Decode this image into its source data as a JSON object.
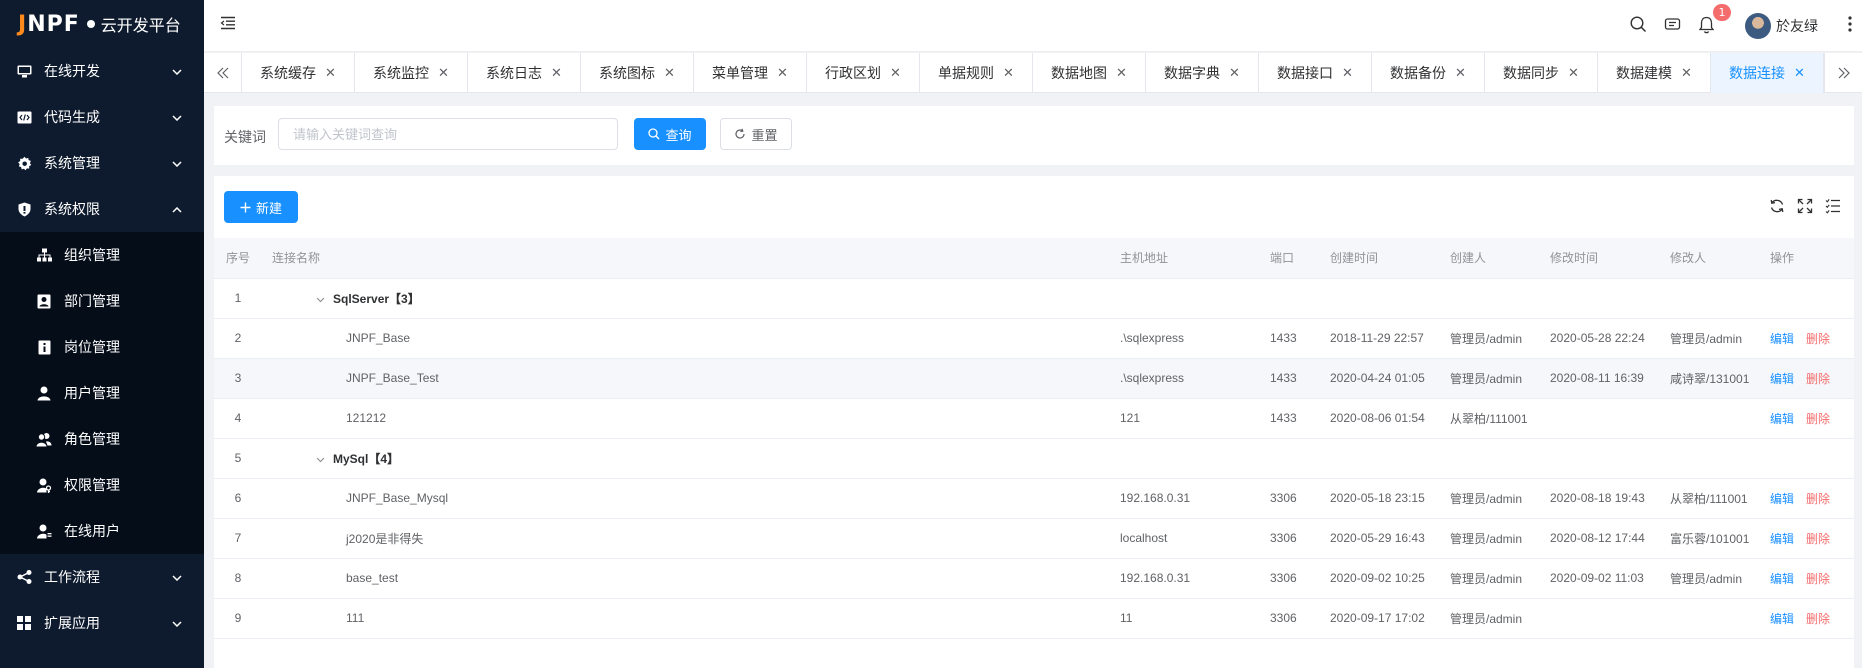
{
  "app": {
    "brand": "JNPF",
    "brand_first": "J",
    "brand_rest": "NPF",
    "platform": "云开发平台"
  },
  "sidebar": {
    "menus": [
      {
        "label": "在线开发",
        "icon": "monitor-icon"
      },
      {
        "label": "代码生成",
        "icon": "code-icon"
      },
      {
        "label": "系统管理",
        "icon": "gear-icon"
      },
      {
        "label": "系统权限",
        "icon": "shield-icon"
      }
    ],
    "sub_items": [
      {
        "label": "组织管理",
        "icon": "org-tree-icon"
      },
      {
        "label": "部门管理",
        "icon": "id-card-icon"
      },
      {
        "label": "岗位管理",
        "icon": "post-icon"
      },
      {
        "label": "用户管理",
        "icon": "user-icon"
      },
      {
        "label": "角色管理",
        "icon": "users-icon"
      },
      {
        "label": "权限管理",
        "icon": "user-key-icon"
      },
      {
        "label": "在线用户",
        "icon": "user-online-icon"
      }
    ],
    "bottom_menus": [
      {
        "label": "工作流程",
        "icon": "share-icon"
      },
      {
        "label": "扩展应用",
        "icon": "grid-icon"
      }
    ]
  },
  "header": {
    "notification_count": "1",
    "username": "於友绿"
  },
  "tabs": [
    {
      "label": "系统缓存"
    },
    {
      "label": "系统监控"
    },
    {
      "label": "系统日志"
    },
    {
      "label": "系统图标"
    },
    {
      "label": "菜单管理"
    },
    {
      "label": "行政区划"
    },
    {
      "label": "单据规则"
    },
    {
      "label": "数据地图"
    },
    {
      "label": "数据字典"
    },
    {
      "label": "数据接口"
    },
    {
      "label": "数据备份"
    },
    {
      "label": "数据同步"
    },
    {
      "label": "数据建模"
    },
    {
      "label": "数据连接",
      "active": true
    }
  ],
  "search": {
    "keyword_label": "关键词",
    "keyword_placeholder": "请输入关键词查询",
    "keyword_value": "",
    "query_label": "查询",
    "reset_label": "重置"
  },
  "toolbar": {
    "new_label": "新建"
  },
  "table": {
    "columns": [
      "序号",
      "连接名称",
      "主机地址",
      "端口",
      "创建时间",
      "创建人",
      "修改时间",
      "修改人",
      "操作"
    ],
    "edit_label": "编辑",
    "delete_label": "删除",
    "rows": [
      {
        "idx": "1",
        "group": true,
        "name": "SqlServer【3】"
      },
      {
        "idx": "2",
        "name": "JNPF_Base",
        "host": ".\\sqlexpress",
        "port": "1433",
        "created": "2018-11-29 22:57",
        "creator": "管理员/admin",
        "modified": "2020-05-28 22:24",
        "modifier": "管理员/admin"
      },
      {
        "idx": "3",
        "name": "JNPF_Base_Test",
        "host": ".\\sqlexpress",
        "port": "1433",
        "created": "2020-04-24 01:05",
        "creator": "管理员/admin",
        "modified": "2020-08-11 16:39",
        "modifier": "咸诗翠/131001"
      },
      {
        "idx": "4",
        "name": "121212",
        "host": "121",
        "port": "1433",
        "created": "2020-08-06 01:54",
        "creator": "从翠柏/111001",
        "modified": "",
        "modifier": ""
      },
      {
        "idx": "5",
        "group": true,
        "name": "MySql【4】"
      },
      {
        "idx": "6",
        "name": "JNPF_Base_Mysql",
        "host": "192.168.0.31",
        "port": "3306",
        "created": "2020-05-18 23:15",
        "creator": "管理员/admin",
        "modified": "2020-08-18 19:43",
        "modifier": "从翠柏/111001"
      },
      {
        "idx": "7",
        "name": "j2020是非得失",
        "host": "localhost",
        "port": "3306",
        "created": "2020-05-29 16:43",
        "creator": "管理员/admin",
        "modified": "2020-08-12 17:44",
        "modifier": "富乐蓉/101001"
      },
      {
        "idx": "8",
        "name": "base_test",
        "host": "192.168.0.31",
        "port": "3306",
        "created": "2020-09-02 10:25",
        "creator": "管理员/admin",
        "modified": "2020-09-02 11:03",
        "modifier": "管理员/admin"
      },
      {
        "idx": "9",
        "name": "111",
        "host": "11",
        "port": "3306",
        "created": "2020-09-17 17:02",
        "creator": "管理员/admin",
        "modified": "",
        "modifier": ""
      }
    ]
  },
  "colors": {
    "sidebar_bg": "#0e1b2e",
    "submenu_bg": "#050d19",
    "primary": "#1890ff",
    "danger": "#f56c6c",
    "brand_accent": "#ff8a1c"
  }
}
